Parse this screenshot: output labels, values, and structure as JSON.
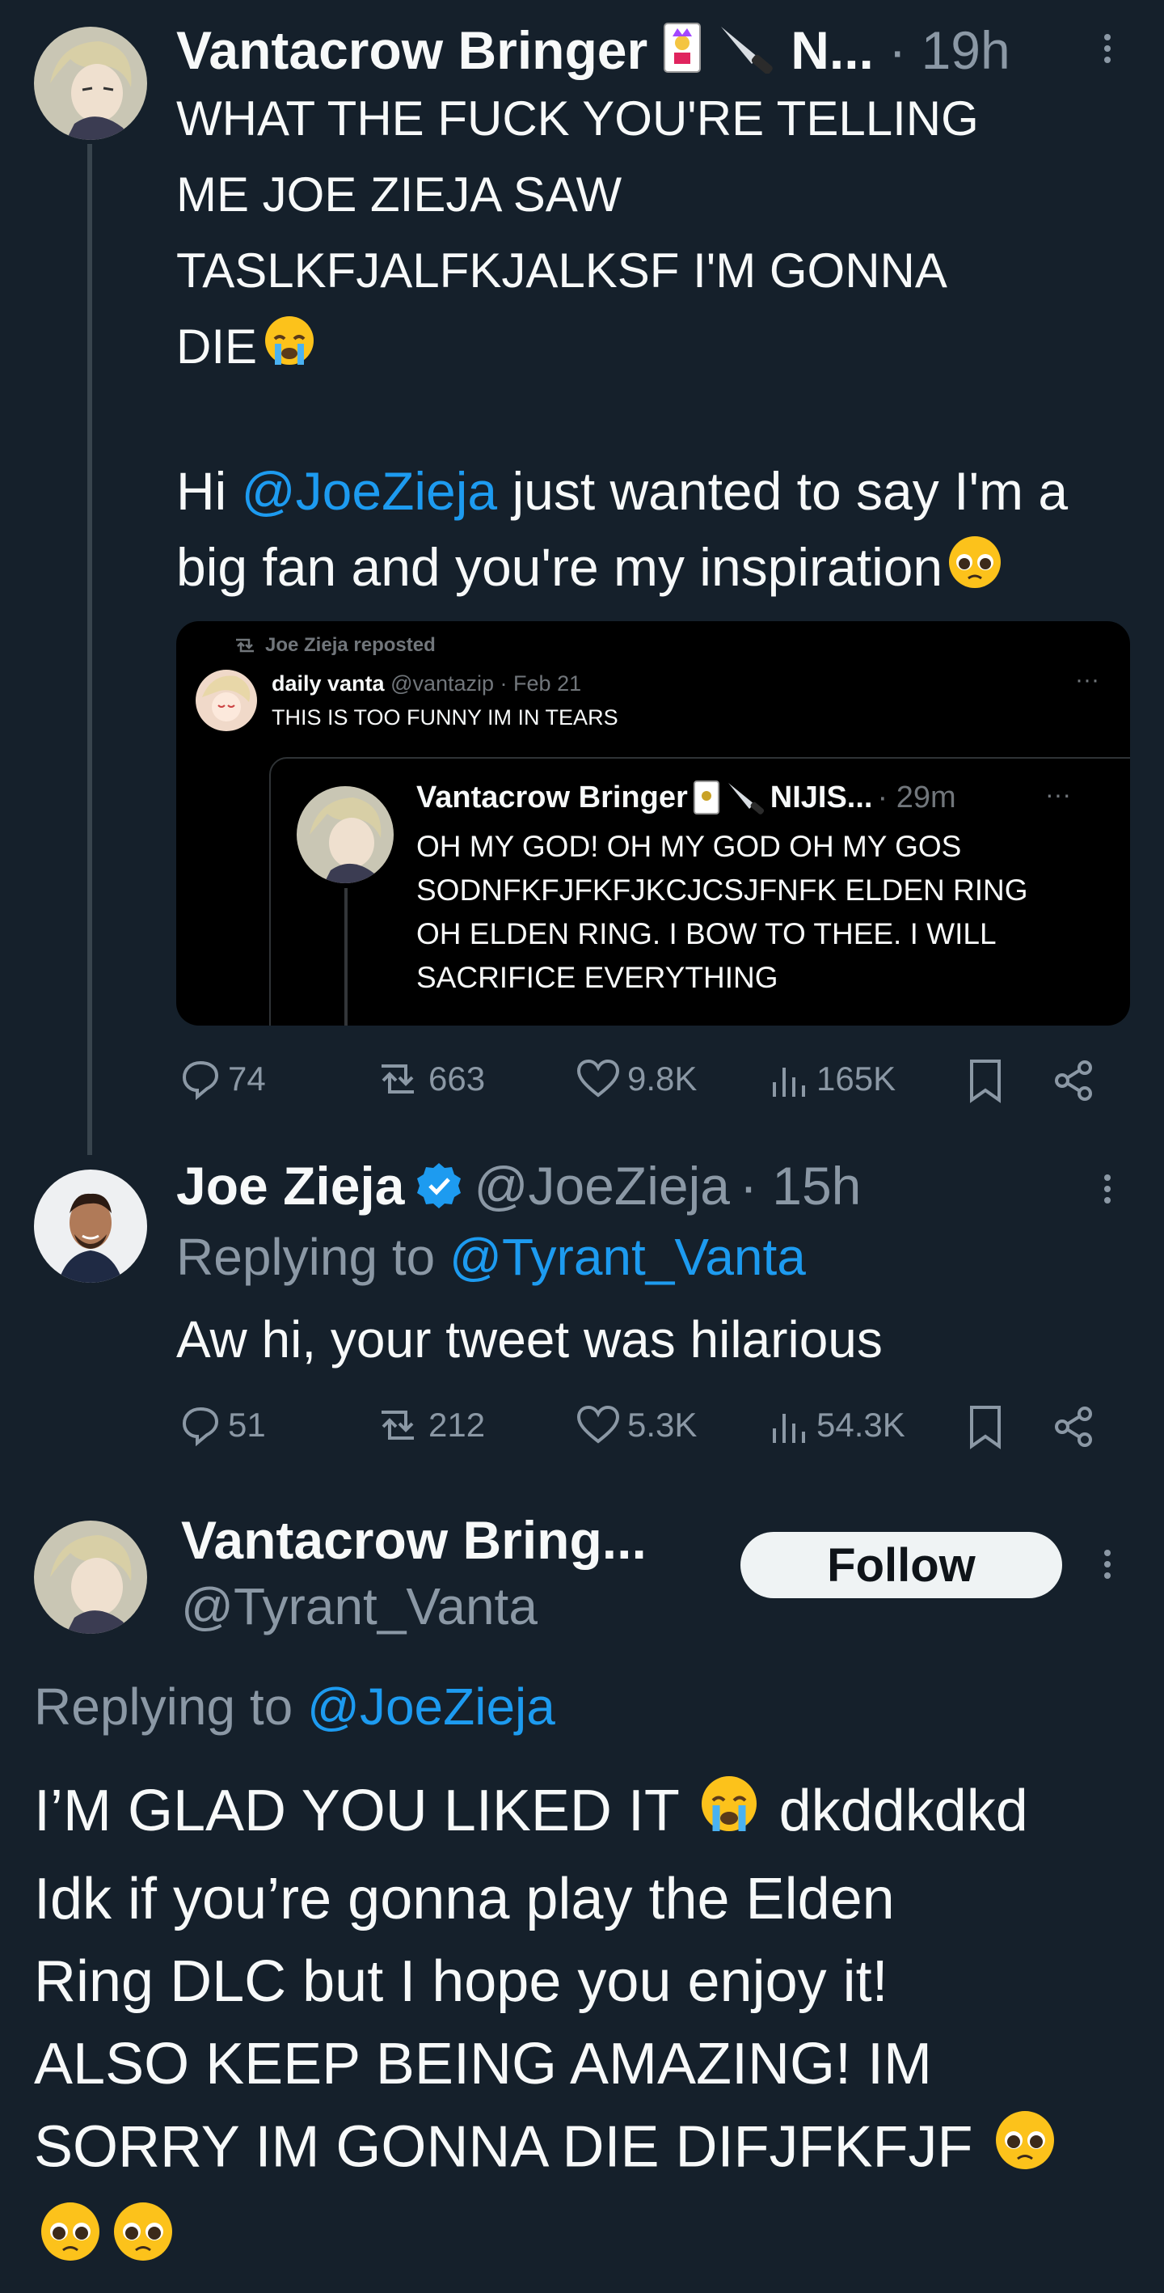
{
  "tweet1": {
    "author_name": "Vantacrow Bringer",
    "author_name_suffix": "N...",
    "dot": "·",
    "time": "19h",
    "text_line1": "WHAT THE FUCK YOU'RE TELLING",
    "text_line2": "ME JOE ZIEJA SAW",
    "text_line3": "TASLKFJALFKJALKSF I'M GONNA",
    "text_line4": "DIE",
    "hi_prefix": "Hi ",
    "mention": "@JoeZieja",
    "hi_rest": " just wanted to say I'm a",
    "text_line6": "big fan and you're my inspiration",
    "embed": {
      "reposted_label": "Joe Zieja reposted",
      "author_name": "daily vanta",
      "handle_time": "@vantazip · Feb 21",
      "text": "THIS IS TOO FUNNY IM IN TEARS",
      "quote_author": "Vantacrow Bringer",
      "quote_suffix": "NIJIS...",
      "quote_time": "· 29m",
      "quote_line1": "OH MY GOD! OH MY GOD OH MY GOS",
      "quote_line2": "SODNFKFJFKFJKCJCSJFNFK ELDEN RING",
      "quote_line3": "OH ELDEN RING. I BOW TO THEE. I WILL",
      "quote_line4": "SACRIFICE EVERYTHING"
    },
    "stats": {
      "replies": "74",
      "reposts": "663",
      "likes": "9.8K",
      "views": "165K"
    }
  },
  "tweet2": {
    "author_name": "Joe Zieja",
    "handle": "@JoeZieja",
    "time": "· 15h",
    "replying_prefix": "Replying to ",
    "replying_to": "@Tyrant_Vanta",
    "text": "Aw hi, your tweet was hilarious",
    "stats": {
      "replies": "51",
      "reposts": "212",
      "likes": "5.3K",
      "views": "54.3K"
    }
  },
  "tweet3": {
    "author_name": "Vantacrow Bring...",
    "handle": "@Tyrant_Vanta",
    "follow_label": "Follow",
    "replying_prefix": "Replying to ",
    "replying_to": "@JoeZieja",
    "line1a": "I’M GLAD YOU LIKED IT ",
    "line1b": " dkddkdkd",
    "line2": "Idk if you’re gonna play the Elden",
    "line3": "Ring DLC but I hope you enjoy it!",
    "line4": "ALSO KEEP BEING AMAZING! IM",
    "line5": "SORRY IM GONNA DIE DIFJFKFJF "
  },
  "colors": {
    "background": "#15202b",
    "accent": "#1d9bf0",
    "muted": "#8b98a5",
    "verified": "#1d9bf0"
  },
  "icons": [
    "reply-icon",
    "repost-icon",
    "like-icon",
    "views-icon",
    "bookmark-icon",
    "share-icon",
    "verified-badge-icon",
    "more-icon"
  ]
}
